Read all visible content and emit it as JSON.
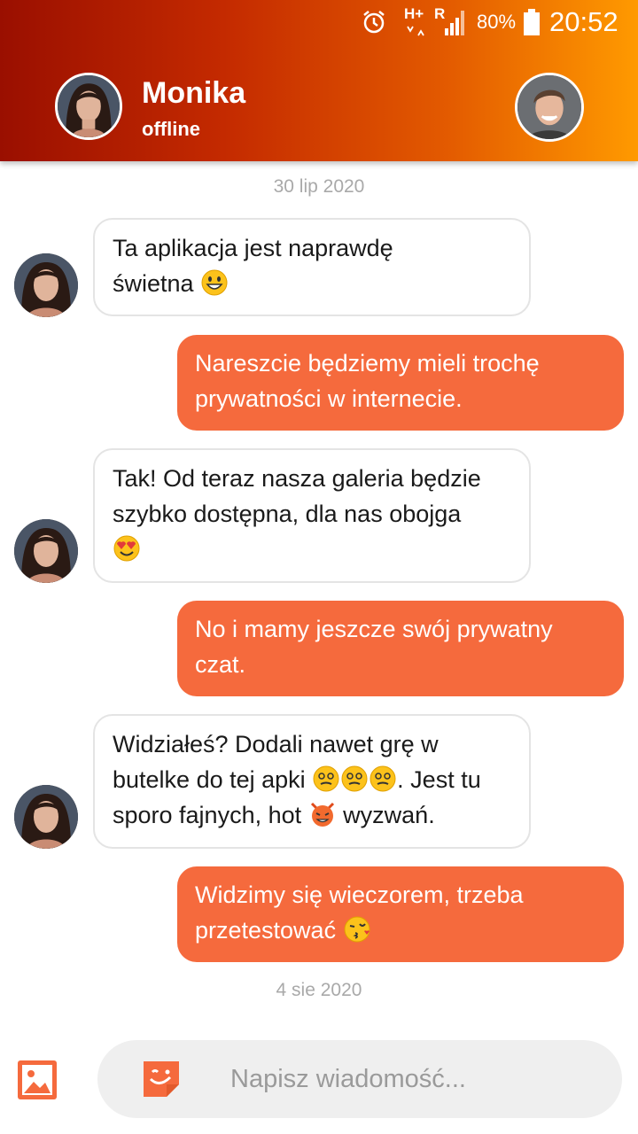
{
  "status_bar": {
    "network_label": "H+",
    "roaming_label": "R",
    "battery": "80%",
    "time": "20:52"
  },
  "header": {
    "contact_name": "Monika",
    "contact_status": "offline"
  },
  "dates": [
    "30 lip 2020",
    "4 sie 2020"
  ],
  "messages": [
    {
      "dir": "in",
      "parts": [
        "Ta aplikacja jest naprawdę",
        "świetna"
      ]
    },
    {
      "dir": "out",
      "text": "Nareszcie będziemy mieli trochę prywatności w internecie."
    },
    {
      "dir": "in",
      "parts": [
        "Tak! Od teraz nasza galeria będzie szybko dostępna, dla nas obojga"
      ]
    },
    {
      "dir": "out",
      "text": "No i mamy jeszcze swój prywatny czat."
    },
    {
      "dir": "in",
      "parts": [
        "Widziałeś? Dodali nawet grę w butelke do tej apki",
        ". Jest tu sporo fajnych, hot",
        "wyzwań."
      ]
    },
    {
      "dir": "out",
      "parts": [
        "Widzimy się wieczorem, trzeba przetestować"
      ]
    }
  ],
  "composer": {
    "placeholder": "Napisz wiadomość..."
  },
  "colors": {
    "accent": "#f56a3d",
    "header_start": "#9a0f00",
    "header_end": "#ff9a00"
  },
  "icons": {
    "gallery": "image-icon",
    "sticker": "sticker-icon",
    "alarm": "alarm-icon"
  }
}
